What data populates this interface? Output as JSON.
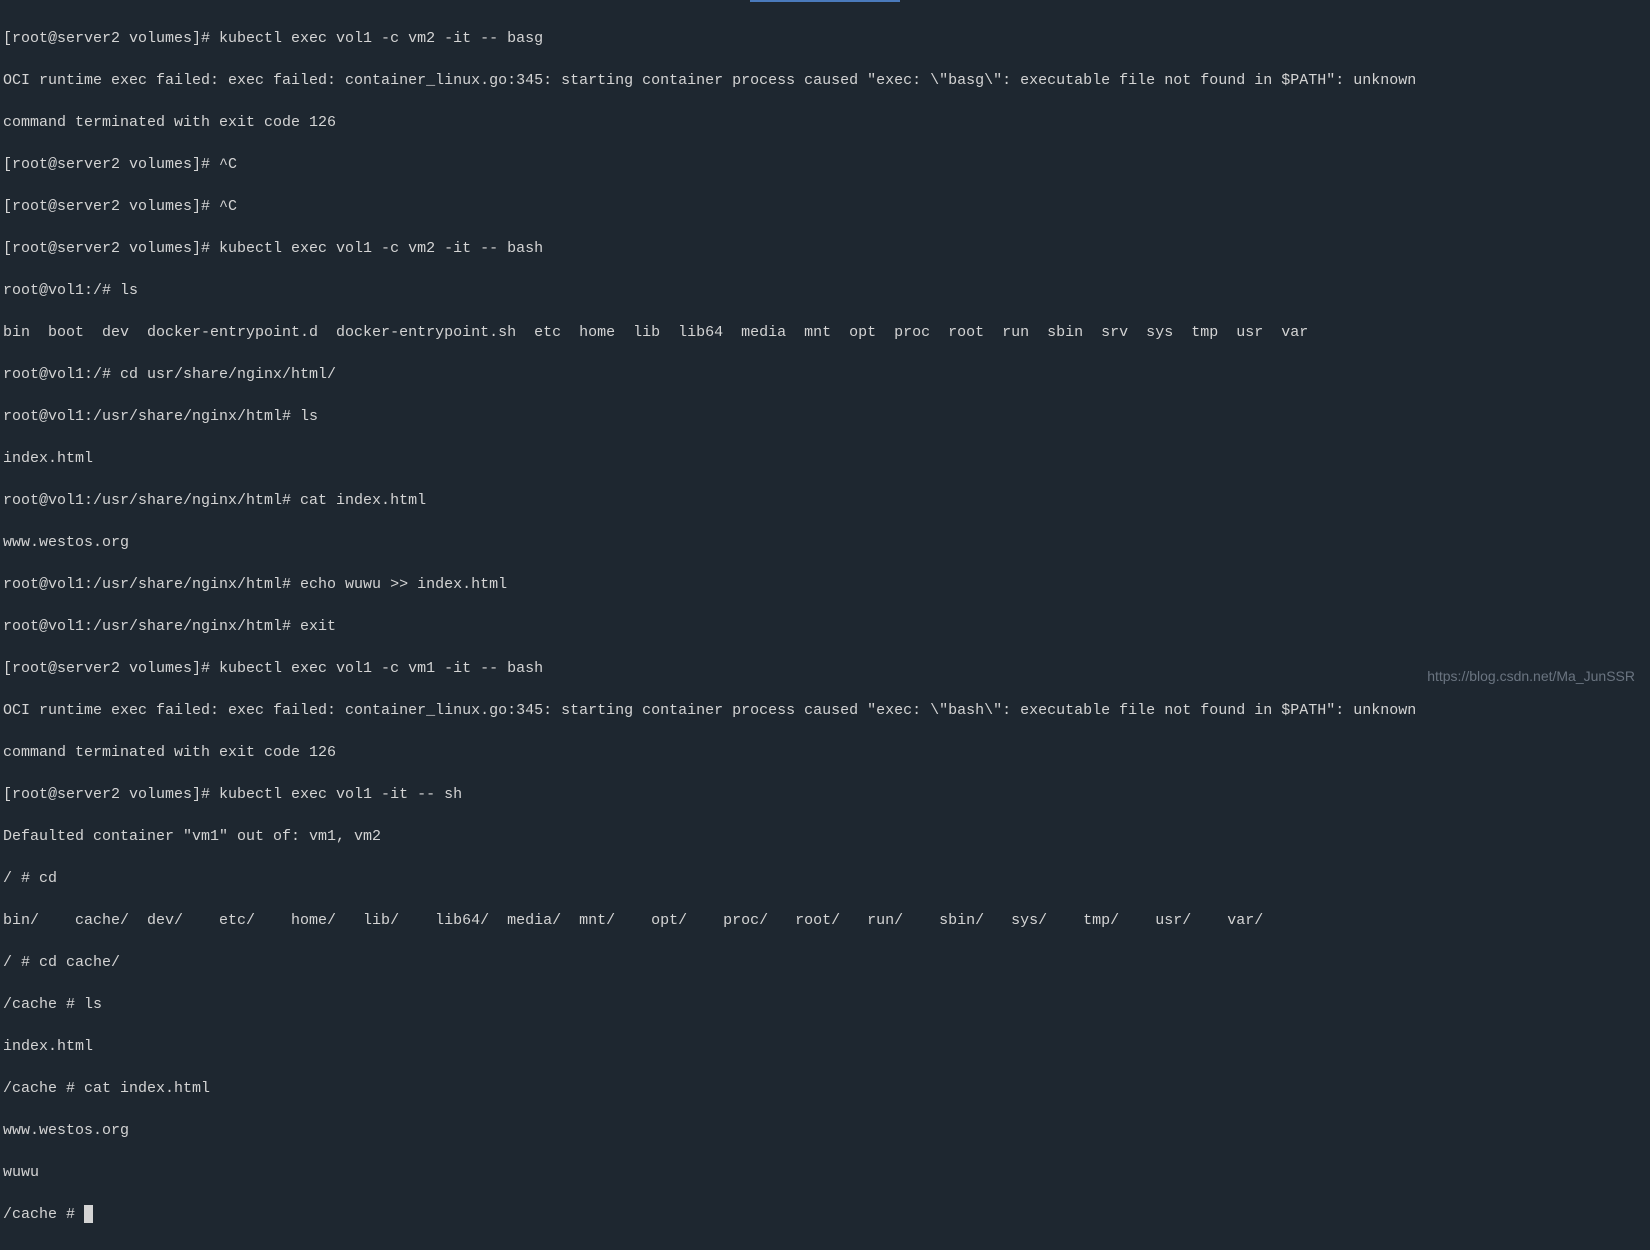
{
  "terminal": {
    "lines": [
      "[root@server2 volumes]# kubectl exec vol1 -c vm2 -it -- basg",
      "OCI runtime exec failed: exec failed: container_linux.go:345: starting container process caused \"exec: \\\"basg\\\": executable file not found in $PATH\": unknown",
      "command terminated with exit code 126",
      "[root@server2 volumes]# ^C",
      "[root@server2 volumes]# ^C",
      "[root@server2 volumes]# kubectl exec vol1 -c vm2 -it -- bash",
      "root@vol1:/# ls",
      "bin  boot  dev  docker-entrypoint.d  docker-entrypoint.sh  etc  home  lib  lib64  media  mnt  opt  proc  root  run  sbin  srv  sys  tmp  usr  var",
      "root@vol1:/# cd usr/share/nginx/html/",
      "root@vol1:/usr/share/nginx/html# ls",
      "index.html",
      "root@vol1:/usr/share/nginx/html# cat index.html",
      "www.westos.org",
      "root@vol1:/usr/share/nginx/html# echo wuwu >> index.html",
      "root@vol1:/usr/share/nginx/html# exit",
      "[root@server2 volumes]# kubectl exec vol1 -c vm1 -it -- bash",
      "OCI runtime exec failed: exec failed: container_linux.go:345: starting container process caused \"exec: \\\"bash\\\": executable file not found in $PATH\": unknown",
      "command terminated with exit code 126",
      "[root@server2 volumes]# kubectl exec vol1 -it -- sh",
      "Defaulted container \"vm1\" out of: vm1, vm2",
      "/ # cd",
      "bin/    cache/  dev/    etc/    home/   lib/    lib64/  media/  mnt/    opt/    proc/   root/   run/    sbin/   sys/    tmp/    usr/    var/",
      "/ # cd cache/",
      "/cache # ls",
      "index.html",
      "/cache # cat index.html",
      "www.westos.org",
      "wuwu",
      "/cache # "
    ],
    "cursor_line": 28
  },
  "watermark": "https://blog.csdn.net/Ma_JunSSR"
}
